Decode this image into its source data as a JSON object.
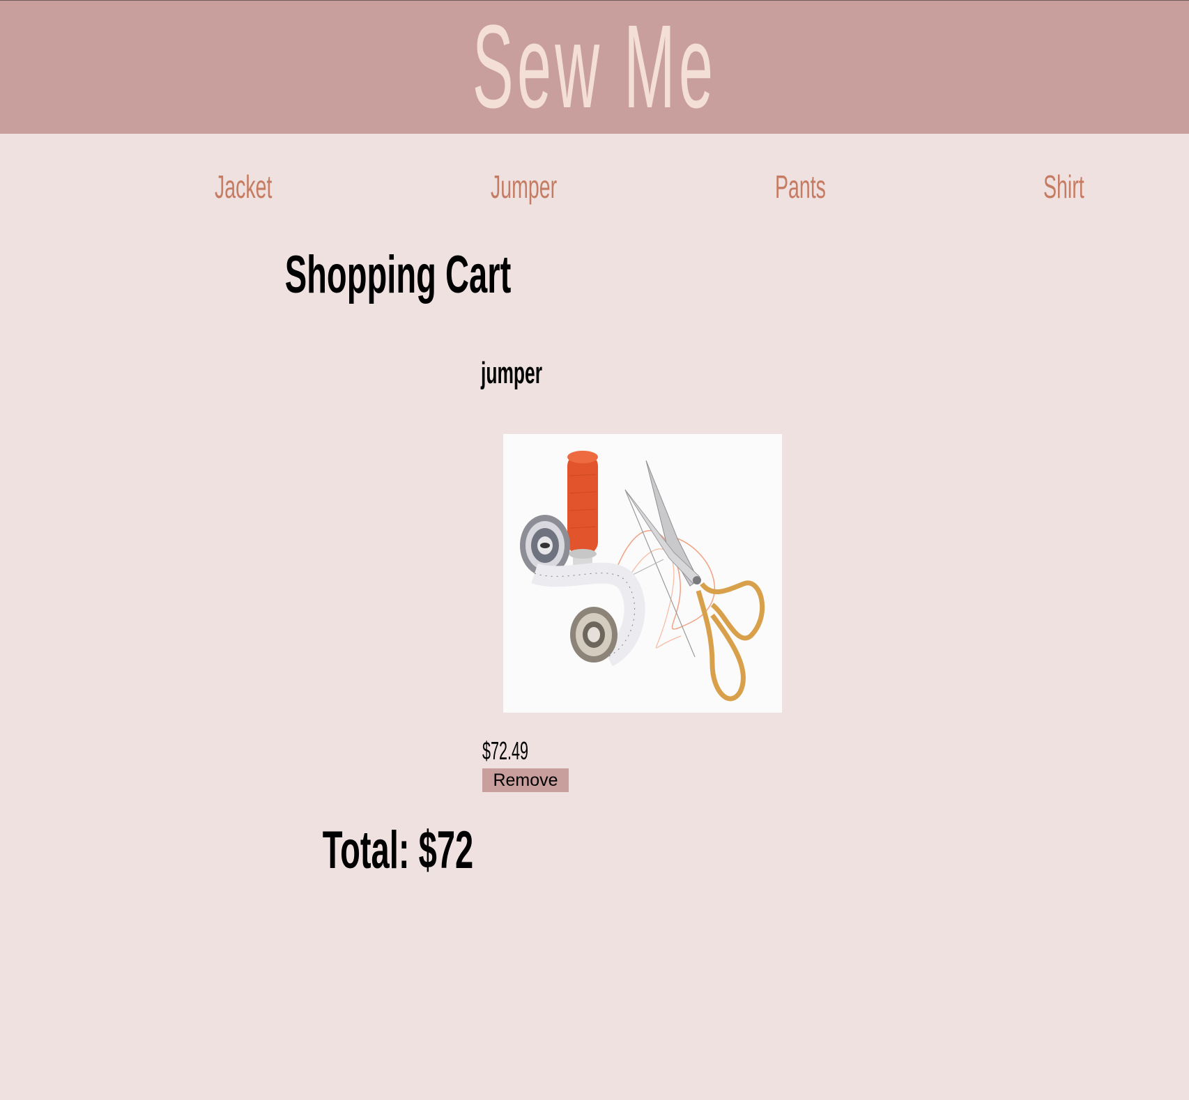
{
  "header": {
    "brand": "Sew Me"
  },
  "nav": {
    "items": [
      {
        "label": "Jacket"
      },
      {
        "label": "Jumper"
      },
      {
        "label": "Pants"
      },
      {
        "label": "Shirt"
      }
    ]
  },
  "cart": {
    "title": "Shopping Cart",
    "items": [
      {
        "name": "jumper",
        "price": "$72.49",
        "remove_label": "Remove",
        "image_icon": "sewing-supplies-photo"
      }
    ],
    "total_text": "Total: $72"
  },
  "colors": {
    "header_bg": "#c89f9c",
    "page_bg": "#efe1e0",
    "brand_text": "#f4dfd6",
    "nav_link": "#c57c62",
    "button_bg": "#c89f9c"
  }
}
